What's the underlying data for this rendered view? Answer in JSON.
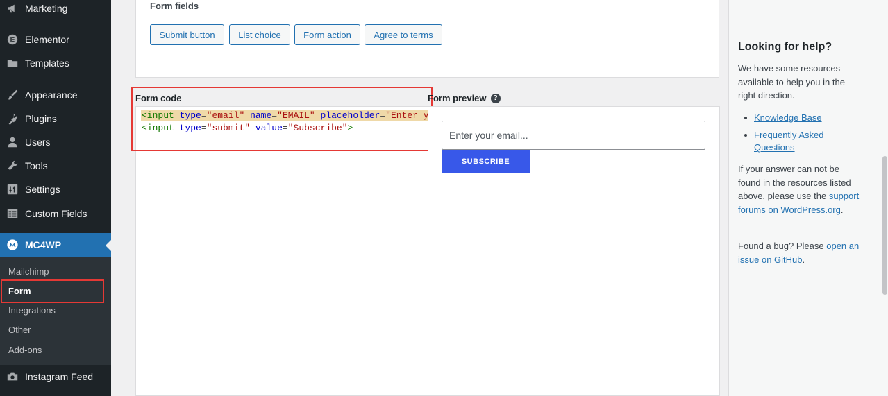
{
  "sidebar": {
    "items": [
      {
        "label": "Marketing",
        "icon": "megaphone-icon"
      },
      {
        "label": "Elementor",
        "icon": "elementor-icon"
      },
      {
        "label": "Templates",
        "icon": "folder-icon"
      },
      {
        "label": "Appearance",
        "icon": "paintbrush-icon"
      },
      {
        "label": "Plugins",
        "icon": "plug-icon"
      },
      {
        "label": "Users",
        "icon": "user-icon"
      },
      {
        "label": "Tools",
        "icon": "wrench-icon"
      },
      {
        "label": "Settings",
        "icon": "sliders-icon"
      },
      {
        "label": "Custom Fields",
        "icon": "grid-icon"
      },
      {
        "label": "MC4WP",
        "icon": "mc4wp-logo-icon"
      },
      {
        "label": "Instagram Feed",
        "icon": "camera-icon"
      }
    ],
    "submenu": [
      "Mailchimp",
      "Form",
      "Integrations",
      "Other",
      "Add-ons"
    ],
    "current_submenu": "Form"
  },
  "form_fields": {
    "title": "Form fields",
    "buttons": [
      "Submit button",
      "List choice",
      "Form action",
      "Agree to terms"
    ]
  },
  "form_code": {
    "label": "Form code",
    "line1": {
      "tag": "<input",
      "attr1": "type",
      "val1": "\"email\"",
      "attr2": "name",
      "val2": "\"EMAIL\"",
      "attr3": "placeholder",
      "val3": "\"Enter y"
    },
    "line2": {
      "tag": "<input",
      "attr1": "type",
      "val1": "\"submit\"",
      "attr2": "value",
      "val2": "\"Subscribe\"",
      "close": ">"
    }
  },
  "form_preview": {
    "label": "Form preview",
    "help_glyph": "?",
    "email_placeholder": "Enter your email...",
    "subscribe_label": "SUBSCRIBE"
  },
  "help": {
    "title": "Looking for help?",
    "intro": "We have some resources available to help you in the right direction.",
    "links": [
      "Knowledge Base",
      "Frequently Asked Questions"
    ],
    "answer_text": "If your answer can not be found in the resources listed above, please use the",
    "answer_link": "support forums on WordPress.org",
    "answer_end": ".",
    "bug_text": "Found a bug? Please",
    "bug_link": "open an issue on GitHub",
    "bug_end": "."
  },
  "colors": {
    "sidebar_bg": "#1d2327",
    "accent": "#2271b1",
    "subscribe_bg": "#3858e9",
    "highlight_red": "#e53935"
  }
}
